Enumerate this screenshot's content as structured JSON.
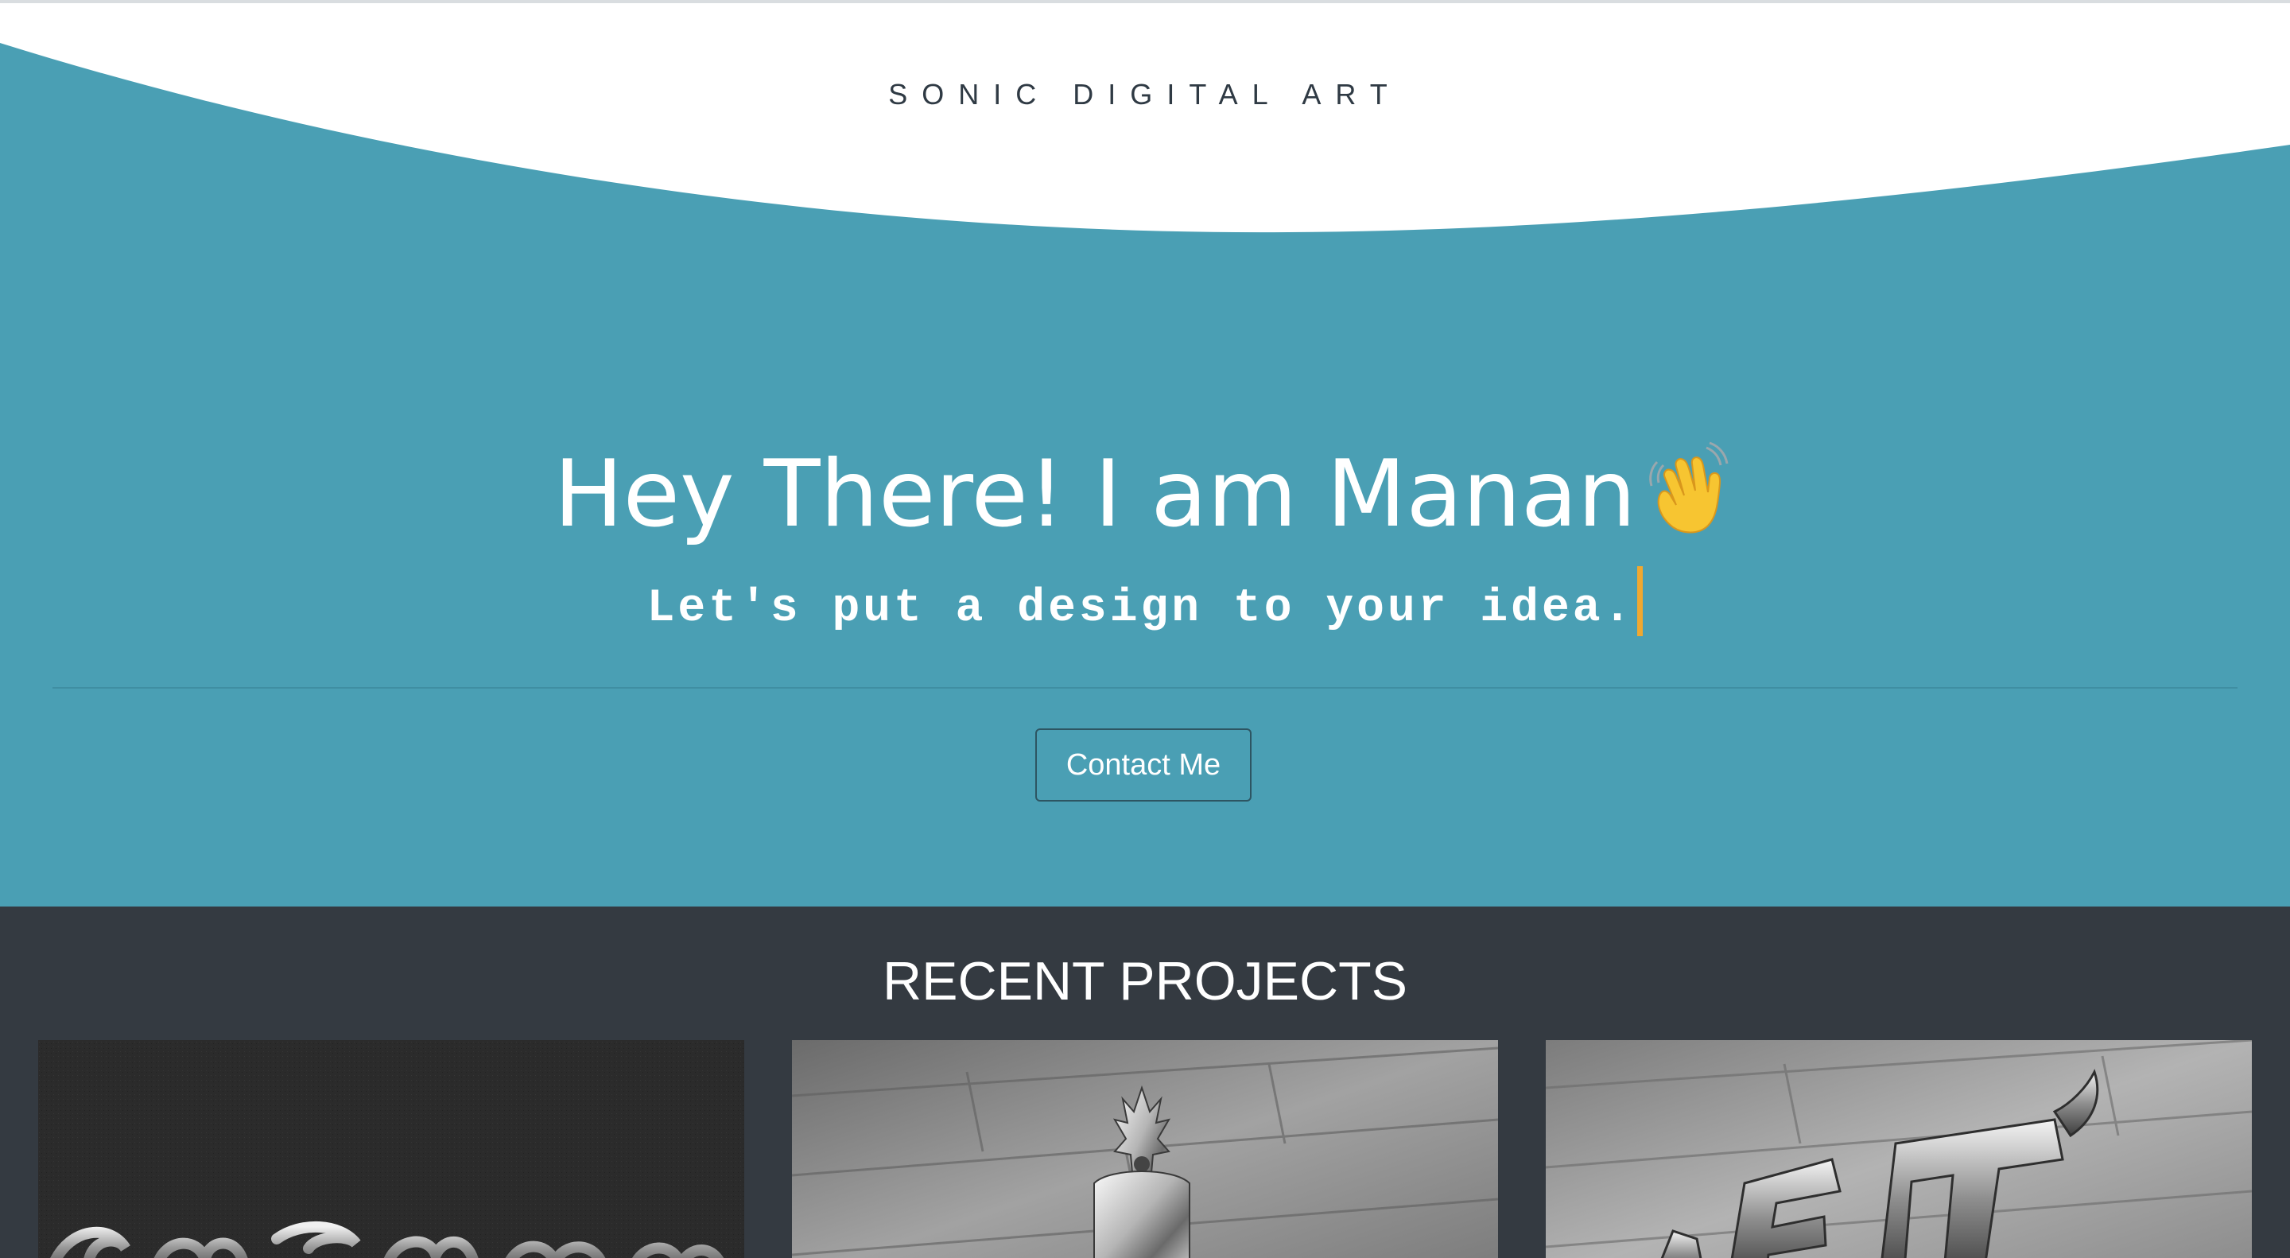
{
  "header": {
    "brand": "SONIC DIGITAL ART"
  },
  "hero": {
    "headline": "Hey There! I am Manan",
    "headline_emoji": "waving-hand-icon",
    "tagline": "Let's put a design to your idea.",
    "contact_button": "Contact Me"
  },
  "projects": {
    "title": "RECENT PROJECTS",
    "cards": [
      {
        "name": "project-card-1",
        "style": "dark textured metallic script logo"
      },
      {
        "name": "project-card-2",
        "style": "chrome trident logo on wooden wall"
      },
      {
        "name": "project-card-3",
        "style": "chrome lettering logo on wooden wall"
      }
    ]
  },
  "colors": {
    "hero_bg": "#4a9fb4",
    "projects_bg": "#343a41",
    "cursor": "#f0a830",
    "brand_text": "#2f3a44"
  }
}
